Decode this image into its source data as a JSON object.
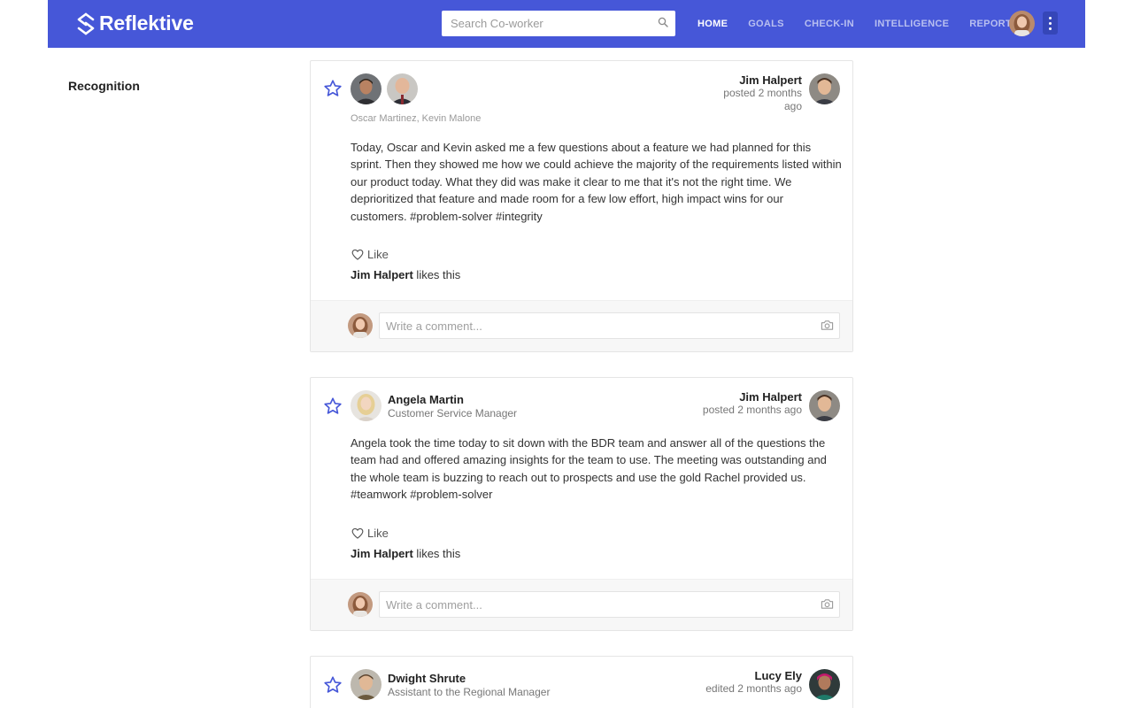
{
  "app": {
    "name": "Reflektive"
  },
  "header": {
    "search_placeholder": "Search Co-worker",
    "nav": [
      {
        "label": "HOME",
        "active": true
      },
      {
        "label": "GOALS",
        "active": false
      },
      {
        "label": "CHECK-IN",
        "active": false
      },
      {
        "label": "INTELLIGENCE",
        "active": false
      },
      {
        "label": "REPORTS",
        "active": false
      }
    ],
    "icons": {
      "search": "search-icon",
      "menu": "kebab-menu-icon"
    },
    "colors": {
      "brand": "#4657d8",
      "accent_star": "#4657d8"
    }
  },
  "page": {
    "section_title": "Recognition"
  },
  "posts": [
    {
      "recipients_text": "Oscar Martinez, Kevin Malone",
      "poster": {
        "name": "Jim Halpert",
        "time_line1": "posted 2 months",
        "time_line2": "ago"
      },
      "body": "Today, Oscar and Kevin asked me a few questions about a feature we had planned for this sprint. Then they showed me how we could achieve the majority of the requirements listed within our product today. What they did was make it clear to me that it's not the right time. We deprioritized that feature and made room for a few low effort, high impact wins for our customers. #problem-solver #integrity",
      "like_label": "Like",
      "likes_name": "Jim Halpert",
      "likes_suffix": " likes this",
      "comment_placeholder": "Write a comment..."
    },
    {
      "recipient": {
        "name": "Angela Martin",
        "title": "Customer Service Manager"
      },
      "poster": {
        "name": "Jim Halpert",
        "time": "posted 2 months ago"
      },
      "body": "Angela took the time today to sit down with the BDR team and answer all of the questions the team had and offered amazing insights for the team to use. The meeting was outstanding and the whole team is buzzing to reach out to prospects and use the gold Rachel provided us. #teamwork #problem-solver",
      "like_label": "Like",
      "likes_name": "Jim Halpert",
      "likes_suffix": " likes this",
      "comment_placeholder": "Write a comment..."
    },
    {
      "recipient": {
        "name": "Dwight Shrute",
        "title": "Assistant to the Regional Manager"
      },
      "poster": {
        "name": "Lucy Ely",
        "time": "edited 2 months ago"
      }
    }
  ]
}
